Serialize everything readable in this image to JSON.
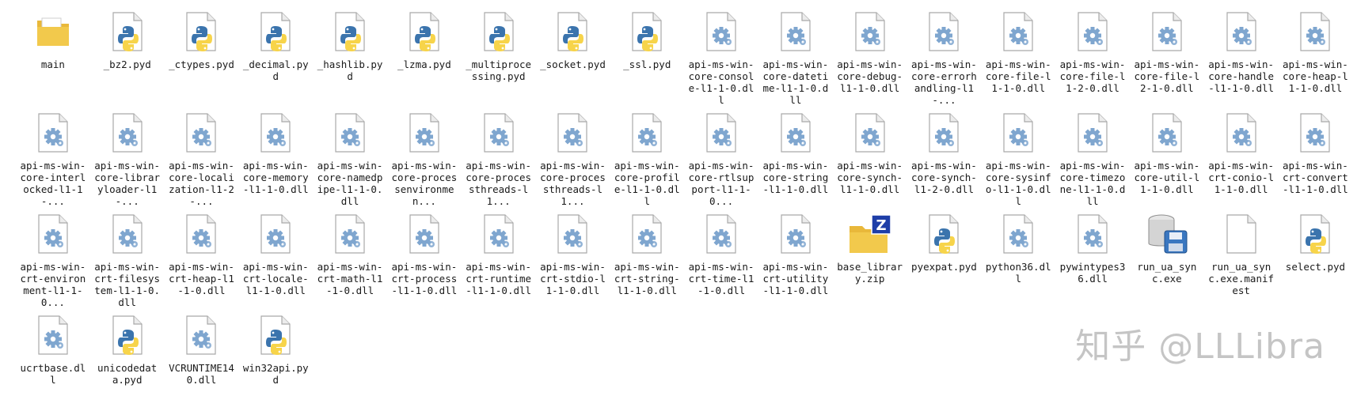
{
  "colors": {
    "page_bg": "#ffffff",
    "folder": "#f2c94c",
    "python_blue": "#3b74ad",
    "python_yellow": "#f7d44a",
    "gear": "#7fa6cf",
    "zip_badge": "#1e3ea8"
  },
  "files": [
    {
      "label": "main",
      "icon": "folder-icon"
    },
    {
      "label": "_bz2.pyd",
      "icon": "python-file-icon"
    },
    {
      "label": "_ctypes.pyd",
      "icon": "python-file-icon"
    },
    {
      "label": "_decimal.pyd",
      "icon": "python-file-icon"
    },
    {
      "label": "_hashlib.pyd",
      "icon": "python-file-icon"
    },
    {
      "label": "_lzma.pyd",
      "icon": "python-file-icon"
    },
    {
      "label": "_multiprocessing.pyd",
      "icon": "python-file-icon"
    },
    {
      "label": "_socket.pyd",
      "icon": "python-file-icon"
    },
    {
      "label": "_ssl.pyd",
      "icon": "python-file-icon"
    },
    {
      "label": "api-ms-win-core-console-l1-1-0.dll",
      "icon": "dll-file-icon"
    },
    {
      "label": "api-ms-win-core-datetime-l1-1-0.dll",
      "icon": "dll-file-icon"
    },
    {
      "label": "api-ms-win-core-debug-l1-1-0.dll",
      "icon": "dll-file-icon"
    },
    {
      "label": "api-ms-win-core-errorhandling-l1-...",
      "icon": "dll-file-icon"
    },
    {
      "label": "api-ms-win-core-file-l1-1-0.dll",
      "icon": "dll-file-icon"
    },
    {
      "label": "api-ms-win-core-file-l1-2-0.dll",
      "icon": "dll-file-icon"
    },
    {
      "label": "api-ms-win-core-file-l2-1-0.dll",
      "icon": "dll-file-icon"
    },
    {
      "label": "api-ms-win-core-handle-l1-1-0.dll",
      "icon": "dll-file-icon"
    },
    {
      "label": "api-ms-win-core-heap-l1-1-0.dll",
      "icon": "dll-file-icon"
    },
    {
      "label": "api-ms-win-core-interlocked-l1-1-...",
      "icon": "dll-file-icon"
    },
    {
      "label": "api-ms-win-core-libraryloader-l1-...",
      "icon": "dll-file-icon"
    },
    {
      "label": "api-ms-win-core-localization-l1-2-...",
      "icon": "dll-file-icon"
    },
    {
      "label": "api-ms-win-core-memory-l1-1-0.dll",
      "icon": "dll-file-icon"
    },
    {
      "label": "api-ms-win-core-namedpipe-l1-1-0.dll",
      "icon": "dll-file-icon"
    },
    {
      "label": "api-ms-win-core-processenvironmen...",
      "icon": "dll-file-icon"
    },
    {
      "label": "api-ms-win-core-processthreads-l1...",
      "icon": "dll-file-icon"
    },
    {
      "label": "api-ms-win-core-processthreads-l1...",
      "icon": "dll-file-icon"
    },
    {
      "label": "api-ms-win-core-profile-l1-1-0.dll",
      "icon": "dll-file-icon"
    },
    {
      "label": "api-ms-win-core-rtlsupport-l1-1-0...",
      "icon": "dll-file-icon"
    },
    {
      "label": "api-ms-win-core-string-l1-1-0.dll",
      "icon": "dll-file-icon"
    },
    {
      "label": "api-ms-win-core-synch-l1-1-0.dll",
      "icon": "dll-file-icon"
    },
    {
      "label": "api-ms-win-core-synch-l1-2-0.dll",
      "icon": "dll-file-icon"
    },
    {
      "label": "api-ms-win-core-sysinfo-l1-1-0.dll",
      "icon": "dll-file-icon"
    },
    {
      "label": "api-ms-win-core-timezone-l1-1-0.dll",
      "icon": "dll-file-icon"
    },
    {
      "label": "api-ms-win-core-util-l1-1-0.dll",
      "icon": "dll-file-icon"
    },
    {
      "label": "api-ms-win-crt-conio-l1-1-0.dll",
      "icon": "dll-file-icon"
    },
    {
      "label": "api-ms-win-crt-convert-l1-1-0.dll",
      "icon": "dll-file-icon"
    },
    {
      "label": "api-ms-win-crt-environment-l1-1-0...",
      "icon": "dll-file-icon"
    },
    {
      "label": "api-ms-win-crt-filesystem-l1-1-0.dll",
      "icon": "dll-file-icon"
    },
    {
      "label": "api-ms-win-crt-heap-l1-1-0.dll",
      "icon": "dll-file-icon"
    },
    {
      "label": "api-ms-win-crt-locale-l1-1-0.dll",
      "icon": "dll-file-icon"
    },
    {
      "label": "api-ms-win-crt-math-l1-1-0.dll",
      "icon": "dll-file-icon"
    },
    {
      "label": "api-ms-win-crt-process-l1-1-0.dll",
      "icon": "dll-file-icon"
    },
    {
      "label": "api-ms-win-crt-runtime-l1-1-0.dll",
      "icon": "dll-file-icon"
    },
    {
      "label": "api-ms-win-crt-stdio-l1-1-0.dll",
      "icon": "dll-file-icon"
    },
    {
      "label": "api-ms-win-crt-string-l1-1-0.dll",
      "icon": "dll-file-icon"
    },
    {
      "label": "api-ms-win-crt-time-l1-1-0.dll",
      "icon": "dll-file-icon"
    },
    {
      "label": "api-ms-win-crt-utility-l1-1-0.dll",
      "icon": "dll-file-icon"
    },
    {
      "label": "base_library.zip",
      "icon": "zip-folder-icon"
    },
    {
      "label": "pyexpat.pyd",
      "icon": "python-file-icon"
    },
    {
      "label": "python36.dll",
      "icon": "dll-file-icon"
    },
    {
      "label": "pywintypes36.dll",
      "icon": "dll-file-icon"
    },
    {
      "label": "run_ua_sync.exe",
      "icon": "exe-disk-icon"
    },
    {
      "label": "run_ua_sync.exe.manifest",
      "icon": "blank-file-icon"
    },
    {
      "label": "select.pyd",
      "icon": "python-file-icon"
    },
    {
      "label": "ucrtbase.dll",
      "icon": "dll-file-icon"
    },
    {
      "label": "unicodedata.pyd",
      "icon": "python-file-icon"
    },
    {
      "label": "VCRUNTIME140.dll",
      "icon": "dll-file-icon"
    },
    {
      "label": "win32api.pyd",
      "icon": "python-file-icon"
    }
  ],
  "watermark": "知乎 @LLLibra"
}
